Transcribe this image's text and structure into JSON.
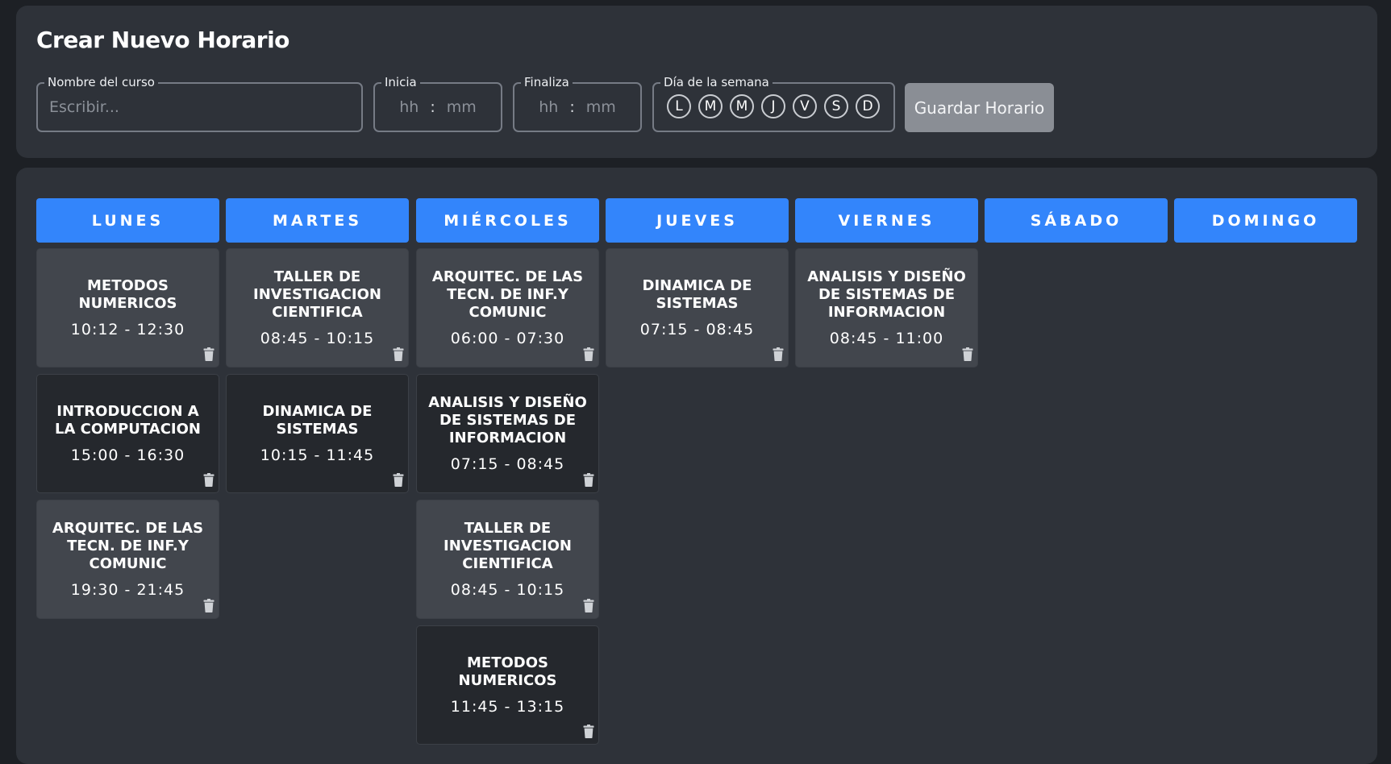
{
  "form": {
    "title": "Crear Nuevo Horario",
    "course": {
      "legend": "Nombre del curso",
      "placeholder": "Escribir..."
    },
    "start": {
      "legend": "Inicia",
      "hh": "hh",
      "mm": "mm"
    },
    "end": {
      "legend": "Finaliza",
      "hh": "hh",
      "mm": "mm"
    },
    "days": {
      "legend": "Día de la semana",
      "letters": [
        "L",
        "M",
        "M",
        "J",
        "V",
        "S",
        "D"
      ]
    },
    "save_label": "Guardar Horario"
  },
  "schedule": {
    "days": [
      "LUNES",
      "MARTES",
      "MIÉRCOLES",
      "JUEVES",
      "VIERNES",
      "SÁBADO",
      "DOMINGO"
    ],
    "columns": [
      [
        {
          "name": "METODOS NUMERICOS",
          "time": "10:12 - 12:30"
        },
        {
          "name": "INTRODUCCION A LA COMPUTACION",
          "time": "15:00 - 16:30"
        },
        {
          "name": "ARQUITEC. DE LAS TECN. DE INF.Y COMUNIC",
          "time": "19:30 - 21:45"
        }
      ],
      [
        {
          "name": "TALLER DE INVESTIGACION CIENTIFICA",
          "time": "08:45 - 10:15"
        },
        {
          "name": "DINAMICA DE SISTEMAS",
          "time": "10:15 - 11:45"
        }
      ],
      [
        {
          "name": "ARQUITEC. DE LAS TECN. DE INF.Y COMUNIC",
          "time": "06:00 - 07:30"
        },
        {
          "name": "ANALISIS Y DISEÑO DE SISTEMAS DE INFORMACION",
          "time": "07:15 - 08:45"
        },
        {
          "name": "TALLER DE INVESTIGACION CIENTIFICA",
          "time": "08:45 - 10:15"
        },
        {
          "name": "METODOS NUMERICOS",
          "time": "11:45 - 13:15"
        }
      ],
      [
        {
          "name": "DINAMICA DE SISTEMAS",
          "time": "07:15 - 08:45"
        }
      ],
      [
        {
          "name": "ANALISIS Y DISEÑO DE SISTEMAS DE INFORMACION",
          "time": "08:45 - 11:00"
        }
      ],
      [],
      []
    ]
  },
  "colors": {
    "accent": "#3385fb",
    "card_light": "#42464d",
    "card_dark": "#25282d",
    "panel": "#2e3239",
    "background": "#1d2025"
  },
  "icons": {
    "delete": "trash-icon"
  }
}
